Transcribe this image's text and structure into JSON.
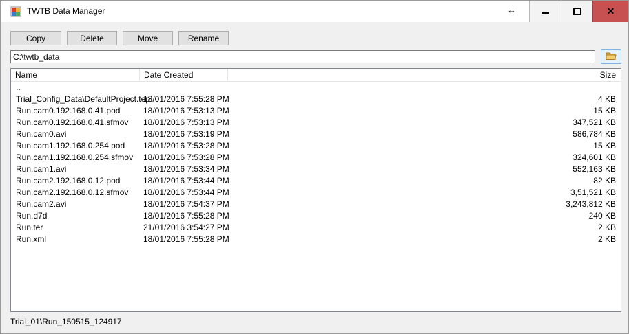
{
  "window": {
    "title": "TWTB Data Manager",
    "icon": "app-icon",
    "controls": {
      "minimize_icon": "minimize-icon",
      "maximize_icon": "maximize-icon",
      "close_glyph": "✕"
    }
  },
  "toolbar": {
    "copy_label": "Copy",
    "delete_label": "Delete",
    "move_label": "Move",
    "rename_label": "Rename"
  },
  "path": {
    "value": "C:\\twtb_data",
    "browse_icon": "folder-icon"
  },
  "list": {
    "columns": [
      "Name",
      "Date Created",
      "Size"
    ],
    "rows": [
      {
        "name": "..",
        "date": "",
        "size": ""
      },
      {
        "name": "Trial_Config_Data\\DefaultProject.tep",
        "date": "18/01/2016 7:55:28 PM",
        "size": "4 KB"
      },
      {
        "name": "Run.cam0.192.168.0.41.pod",
        "date": "18/01/2016 7:53:13 PM",
        "size": "15 KB"
      },
      {
        "name": "Run.cam0.192.168.0.41.sfmov",
        "date": "18/01/2016 7:53:13 PM",
        "size": "347,521 KB"
      },
      {
        "name": "Run.cam0.avi",
        "date": "18/01/2016 7:53:19 PM",
        "size": "586,784 KB"
      },
      {
        "name": "Run.cam1.192.168.0.254.pod",
        "date": "18/01/2016 7:53:28 PM",
        "size": "15 KB"
      },
      {
        "name": "Run.cam1.192.168.0.254.sfmov",
        "date": "18/01/2016 7:53:28 PM",
        "size": "324,601 KB"
      },
      {
        "name": "Run.cam1.avi",
        "date": "18/01/2016 7:53:34 PM",
        "size": "552,163 KB"
      },
      {
        "name": "Run.cam2.192.168.0.12.pod",
        "date": "18/01/2016 7:53:44 PM",
        "size": "82 KB"
      },
      {
        "name": "Run.cam2.192.168.0.12.sfmov",
        "date": "18/01/2016 7:53:44 PM",
        "size": "3,51,521 KB"
      },
      {
        "name": "Run.cam2.avi",
        "date": "18/01/2016 7:54:37 PM",
        "size": "3,243,812 KB"
      },
      {
        "name": "Run.d7d",
        "date": "18/01/2016 7:55:28 PM",
        "size": "240 KB"
      },
      {
        "name": "Run.ter",
        "date": "21/01/2016 3:54:27 PM",
        "size": "2 KB"
      },
      {
        "name": "Run.xml",
        "date": "18/01/2016 7:55:28 PM",
        "size": "2 KB"
      }
    ]
  },
  "status": {
    "text": "Trial_01\\Run_150515_124917"
  },
  "colors": {
    "close_button": "#c75050",
    "titlebar": "#ffffff",
    "window_bg": "#f0f0f0",
    "folder": "#e8b04a"
  }
}
